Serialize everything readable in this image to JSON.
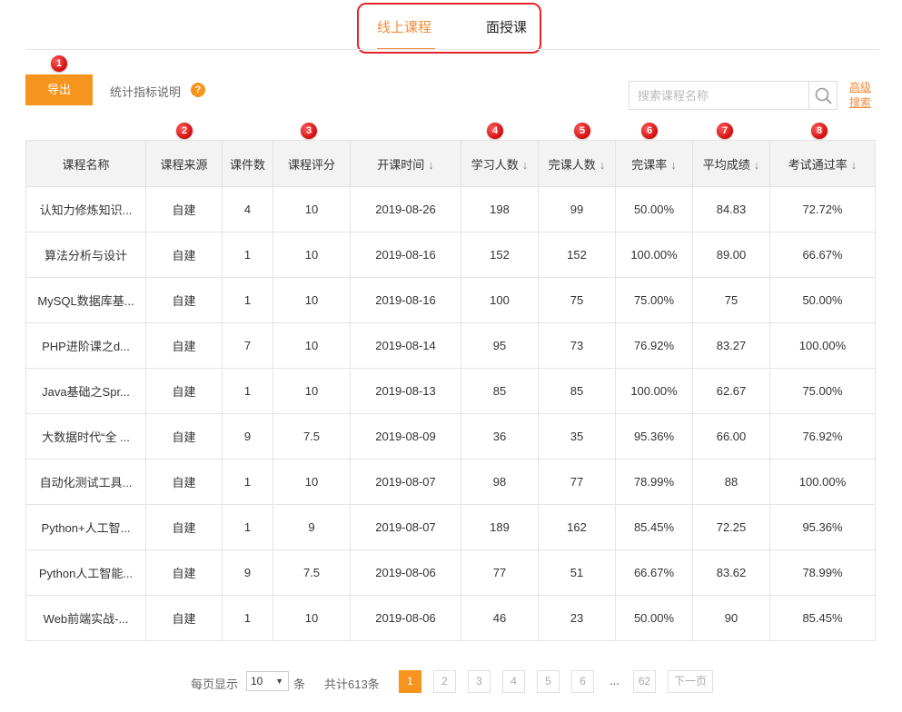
{
  "tabs": [
    {
      "label": "线上课程",
      "active": true
    },
    {
      "label": "面授课",
      "active": false
    }
  ],
  "markers": [
    "1",
    "2",
    "3",
    "4",
    "5",
    "6",
    "7",
    "8"
  ],
  "toolbar": {
    "export_label": "导出",
    "stats_help_label": "统计指标说明",
    "help_icon": "?",
    "search_placeholder": "搜索课程名称",
    "advanced_search_label": "高级搜索"
  },
  "table": {
    "columns": [
      "课程名称",
      "课程来源",
      "课件数",
      "课程评分",
      "开课时间",
      "学习人数",
      "完课人数",
      "完课率",
      "平均成绩",
      "考试通过率"
    ],
    "sort_arrow": "↓",
    "rows": [
      [
        "认知力修炼知识...",
        "自建",
        "4",
        "10",
        "2019-08-26",
        "198",
        "99",
        "50.00%",
        "84.83",
        "72.72%"
      ],
      [
        "算法分析与设计",
        "自建",
        "1",
        "10",
        "2019-08-16",
        "152",
        "152",
        "100.00%",
        "89.00",
        "66.67%"
      ],
      [
        "MySQL数据库基...",
        "自建",
        "1",
        "10",
        "2019-08-16",
        "100",
        "75",
        "75.00%",
        "75",
        "50.00%"
      ],
      [
        "PHP进阶课之d...",
        "自建",
        "7",
        "10",
        "2019-08-14",
        "95",
        "73",
        "76.92%",
        "83.27",
        "100.00%"
      ],
      [
        "Java基础之Spr...",
        "自建",
        "1",
        "10",
        "2019-08-13",
        "85",
        "85",
        "100.00%",
        "62.67",
        "75.00%"
      ],
      [
        "大数据时代“全 ...",
        "自建",
        "9",
        "7.5",
        "2019-08-09",
        "36",
        "35",
        "95.36%",
        "66.00",
        "76.92%"
      ],
      [
        "自动化测试工具...",
        "自建",
        "1",
        "10",
        "2019-08-07",
        "98",
        "77",
        "78.99%",
        "88",
        "100.00%"
      ],
      [
        "Python+人工智...",
        "自建",
        "1",
        "9",
        "2019-08-07",
        "189",
        "162",
        "85.45%",
        "72.25",
        "95.36%"
      ],
      [
        "Python人工智能...",
        "自建",
        "9",
        "7.5",
        "2019-08-06",
        "77",
        "51",
        "66.67%",
        "83.62",
        "78.99%"
      ],
      [
        "Web前端实战-...",
        "自建",
        "1",
        "10",
        "2019-08-06",
        "46",
        "23",
        "50.00%",
        "90",
        "85.45%"
      ]
    ]
  },
  "pagination": {
    "per_page_label": "每页显示",
    "per_page_value": "10",
    "caret": "▼",
    "unit": "条",
    "total": "共计613条",
    "pages": [
      "1",
      "2",
      "3",
      "4",
      "5",
      "6"
    ],
    "ellipsis": "...",
    "last_page": "62",
    "next_label": "下一页"
  }
}
